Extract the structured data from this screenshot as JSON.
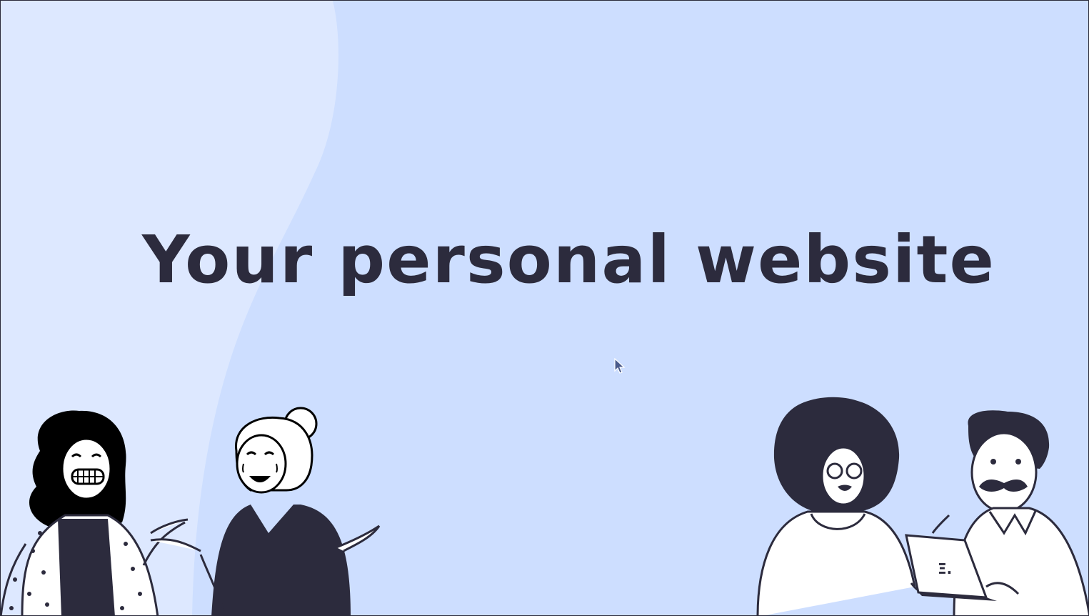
{
  "hero": {
    "headline": "Your personal website"
  },
  "colors": {
    "background": "#cddeff",
    "background_light": "#dde8ff",
    "ink": "#2c2b3d"
  },
  "illustrations": {
    "left": "two-women-laughing-illustration",
    "right": "woman-and-man-with-laptop-illustration"
  },
  "cursor": "mouse-pointer-icon"
}
